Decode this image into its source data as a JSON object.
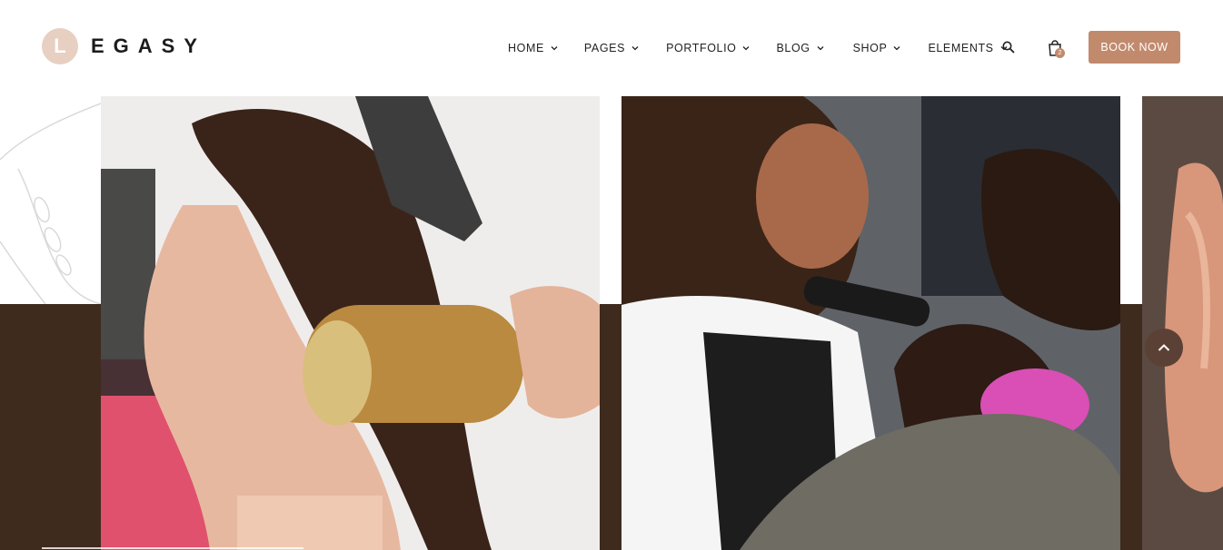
{
  "brand": {
    "logo_letter": "L",
    "logo_text": "EGASY"
  },
  "nav": {
    "items": [
      {
        "label": "HOME",
        "active": true
      },
      {
        "label": "PAGES"
      },
      {
        "label": "PORTFOLIO"
      },
      {
        "label": "BLOG"
      },
      {
        "label": "SHOP"
      },
      {
        "label": "ELEMENTS"
      }
    ]
  },
  "header_actions": {
    "search_icon": "search-icon",
    "cart_icon": "shopping-bag-icon",
    "cart_count": "2",
    "book_label": "BOOK NOW"
  },
  "gallery": {
    "images": [
      {
        "name": "woman-hair-blow-dry-photo"
      },
      {
        "name": "barber-cutting-hair-photo"
      },
      {
        "name": "curly-hair-woman-photo"
      }
    ]
  },
  "colors": {
    "accent": "#c28a6d",
    "logo_circle": "#e7cfc2",
    "dark_brown": "#3f2a1e",
    "scroll_button": "#5b4035"
  },
  "scroll_top_icon": "chevron-up-icon"
}
